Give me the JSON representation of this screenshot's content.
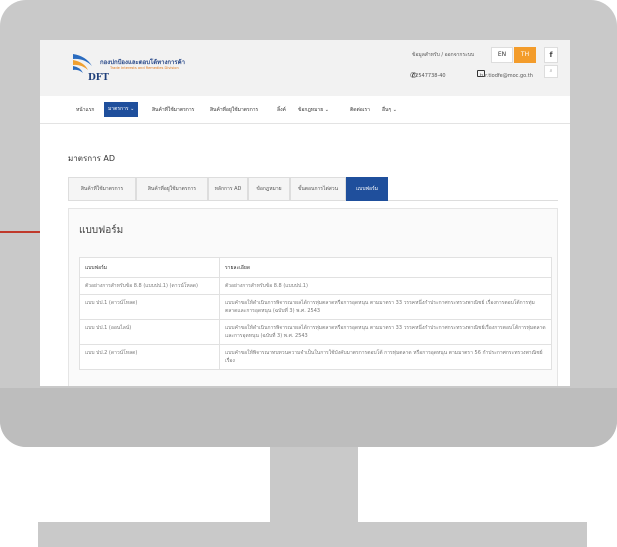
{
  "site": {
    "logo_th": "กองปกป้องและตอบโต้ทางการค้า",
    "logo_en": "Trade Interests and Remedies Division",
    "logo_abbr": "DFT"
  },
  "util": {
    "link": "ข้อมูลสำหรับ / ออกจากระบบ",
    "phone": "02547738-40",
    "email": "tur.tiodfe@moc.go.th",
    "lang_en": "EN",
    "lang_th": "TH",
    "fb": "f"
  },
  "nav": {
    "items": [
      "หน้าแรก",
      "มาตรการ",
      "สินค้าที่ใช้มาตรการ",
      "สินค้าที่อยู่ใช้มาตรการ",
      "ลิ้งค์",
      "ข้อกฎหมาย",
      "ติดต่อเรา",
      "อื่นๆ"
    ],
    "active_index": 1
  },
  "page": {
    "title": "มาตรการ AD"
  },
  "tabs": {
    "items": [
      "สินค้าที่ใช้มาตรการ",
      "สินค้าที่อยู่ใช้มาตรการ",
      "หลักการ AD",
      "ข้อกฎหมาย",
      "ขั้นตอนการไต่สวน",
      "แบบฟอร์ม"
    ],
    "active_index": 5
  },
  "panel": {
    "title": "แบบฟอร์ม",
    "columns": [
      "แบบฟอร์ม",
      "รายละเอียด"
    ],
    "rows": [
      {
        "form": "ตัวอย่างการสำหรับข้อ 8.8 (แบบปป.1) (ดาวน์โหลด)",
        "detail": "ตัวอย่างการสำหรับข้อ 8.8 (แบบปป.1)"
      },
      {
        "form": "แบบ ปป.1 (ดาวน์โหลด)",
        "detail": "แบบคำขอให้ดำเนินการพิจารณาผลได้การทุ่มตลาดหรือการอุดหนุน ตามมาตรา 33 วรรคหนึ่งกำประกาศกระทรวงพาณิชย์ เรื่องการตอบโต้การทุ่มตลาดและการอุดหนุน (ฉบับที่ 3) พ.ศ. 2543"
      },
      {
        "form": "แบบ ปป.1 (ออนไลน์)",
        "detail": "แบบคำขอให้ดำเนินการพิจารณาผลได้การทุ่มตลาดหรือการอุดหนุน ตามมาตรา 33 วรรคหนึ่งกำประกาศกระทรวงพาณิชย์เรื่องการตอบโต้การทุ่มตลาดและการอุดหนุน (ฉบับที่ 3) พ.ศ. 2543"
      },
      {
        "form": "แบบ ปป.2 (ดาวน์โหลด)",
        "detail": "แบบคำขอให้พิจารณาทบทวนความจำเป็นในการใช้บังคับมาตรการตอบโต้ การทุ่มตลาด หรือการอุดหนุน ตามมาตรา 56 กำประกาศกระทรวงพาณิชย์เรื่อง"
      }
    ]
  },
  "colors": {
    "accent": "#1f4f9c",
    "lang_active": "#f39c2b",
    "monitor": "#c9c9c9",
    "pointer_line": "#c0392b"
  }
}
